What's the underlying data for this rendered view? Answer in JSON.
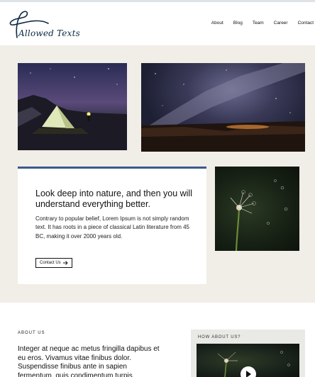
{
  "header": {
    "logo_text": "Allowed Texts",
    "nav": [
      "About",
      "Blog",
      "Team",
      "Career",
      "Contact"
    ]
  },
  "hero": {
    "title": "Look deep into nature, and then you will understand everything better.",
    "body": "Contrary to popular belief, Lorem Ipsum is not simply random text. It has roots in a piece of classical Latin literature from 45 BC, making it over 2000 years old.",
    "button_label": "Contact Us"
  },
  "about": {
    "label": "ABOUT US",
    "text": "Integer at neque ac metus fringilla dapibus et eu eros. Vivamus vitae finibus dolor. Suspendisse finibus ante in sapien fermentum, quis condimentum turpis"
  },
  "how": {
    "label": "HOW ABOUT US?"
  },
  "colors": {
    "band_bg": "#f1ede7",
    "card_accent": "#3b5a8a",
    "logo": "#0d2a44"
  }
}
